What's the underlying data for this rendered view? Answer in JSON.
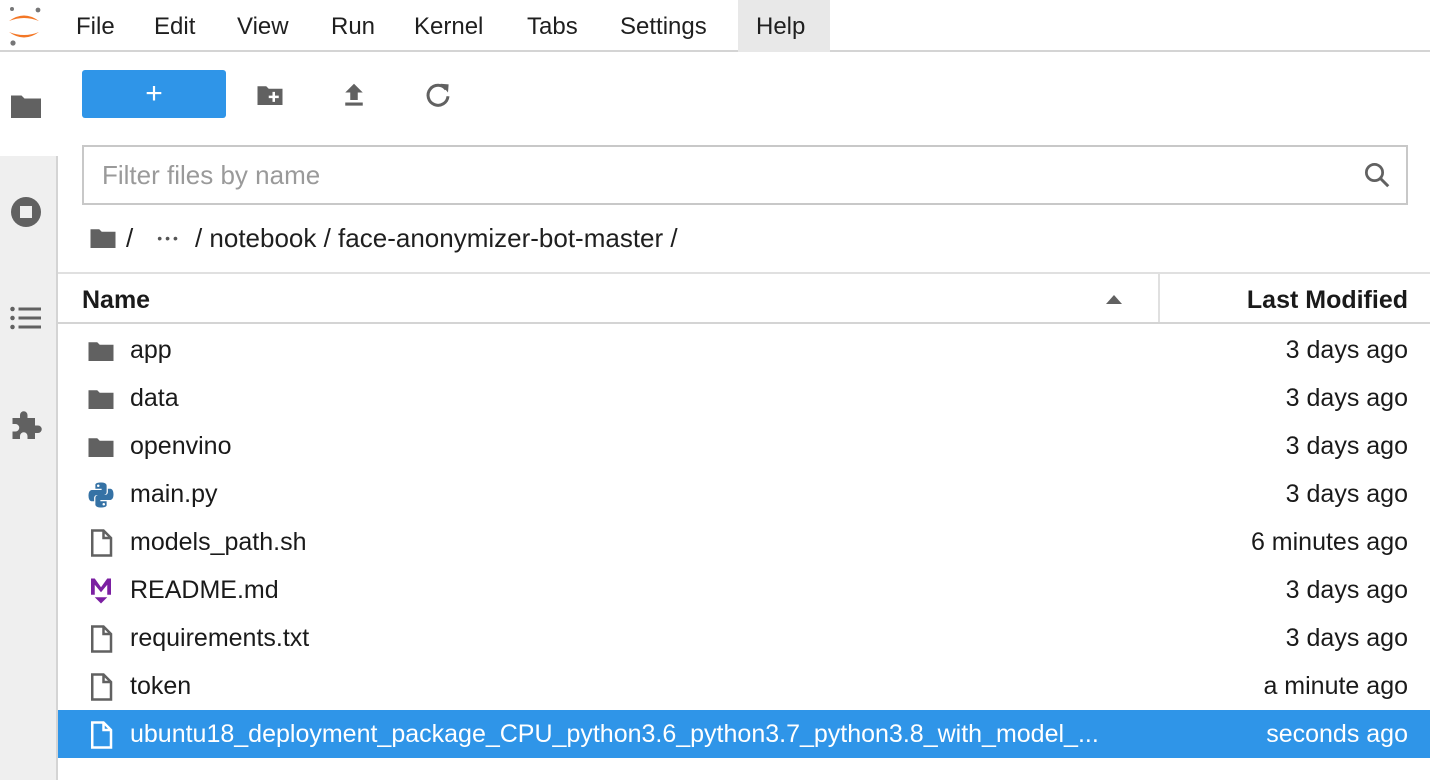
{
  "menu": {
    "items": [
      "File",
      "Edit",
      "View",
      "Run",
      "Kernel",
      "Tabs",
      "Settings",
      "Help"
    ],
    "active": "Help"
  },
  "toolbar": {
    "new_label": "+"
  },
  "filter": {
    "placeholder": "Filter files by name",
    "value": ""
  },
  "breadcrumb": {
    "root": "/",
    "ellipsis": "•••",
    "path": "/ notebook / face-anonymizer-bot-master /"
  },
  "table": {
    "name_header": "Name",
    "modified_header": "Last Modified",
    "sort": "ascending",
    "rows": [
      {
        "name": "app",
        "modified": "3 days ago",
        "icon": "folder-icon"
      },
      {
        "name": "data",
        "modified": "3 days ago",
        "icon": "folder-icon"
      },
      {
        "name": "openvino",
        "modified": "3 days ago",
        "icon": "folder-icon"
      },
      {
        "name": "main.py",
        "modified": "3 days ago",
        "icon": "python-file-icon"
      },
      {
        "name": "models_path.sh",
        "modified": "6 minutes ago",
        "icon": "file-icon"
      },
      {
        "name": "README.md",
        "modified": "3 days ago",
        "icon": "markdown-file-icon"
      },
      {
        "name": "requirements.txt",
        "modified": "3 days ago",
        "icon": "file-icon"
      },
      {
        "name": "token",
        "modified": "a minute ago",
        "icon": "file-icon"
      },
      {
        "name": "ubuntu18_deployment_package_CPU_python3.6_python3.7_python3.8_with_model_...",
        "modified": "seconds ago",
        "icon": "file-icon",
        "selected": true
      }
    ]
  },
  "colors": {
    "accent": "#2f95e8",
    "logo_orange": "#f37726",
    "icon_gray": "#616161",
    "markdown_purple": "#7b1fa2"
  }
}
